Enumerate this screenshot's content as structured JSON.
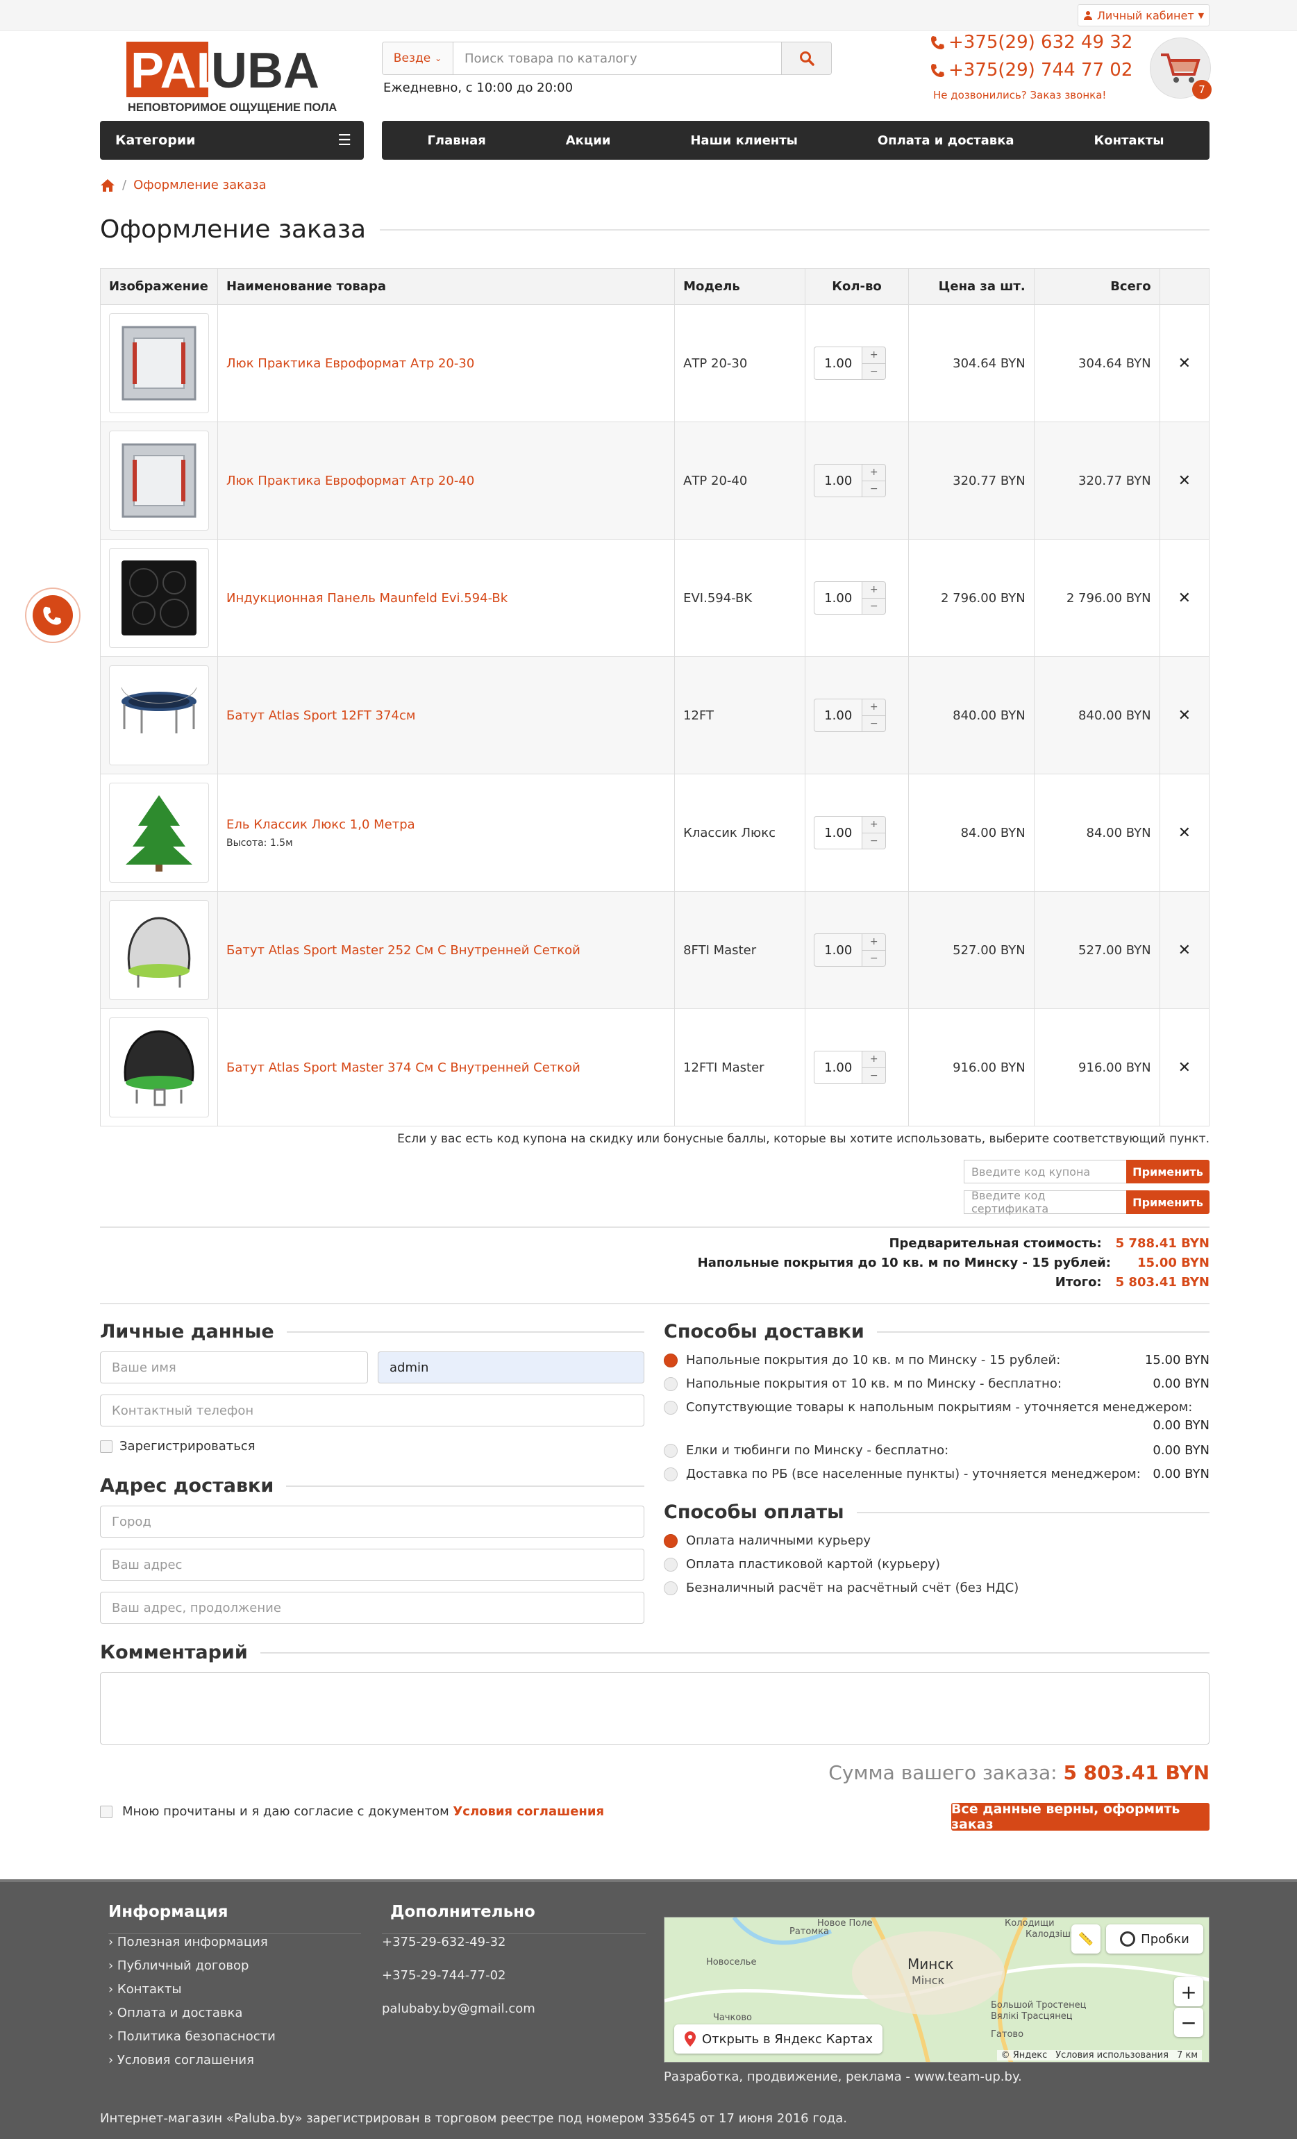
{
  "header": {
    "account_label": "Личный кабинет",
    "logo_text_1": "PAL",
    "logo_text_2": "UBA",
    "logo_slogan": "НЕПОВТОРИМОЕ ОЩУЩЕНИЕ ПОЛА",
    "search_scope": "Везде",
    "search_placeholder": "Поиск товара по каталогу",
    "hours": "Ежедневно, с 10:00 до 20:00",
    "phone_1": "+375(29) 632 49 32",
    "phone_2": "+375(29) 744 77 02",
    "callback": "Не дозвонились? Заказ звонка!",
    "cart_count": "7",
    "categories_label": "Категории",
    "menu": [
      "Главная",
      "Акции",
      "Наши клиенты",
      "Оплата и доставка",
      "Контакты"
    ]
  },
  "breadcrumb": {
    "current": "Оформление заказа"
  },
  "page_title": "Оформление заказа",
  "cart_table": {
    "headers": [
      "Изображение",
      "Наименование товара",
      "Модель",
      "Кол-во",
      "Цена за шт.",
      "Всего"
    ],
    "rows": [
      {
        "name": "Люк Практика Евроформат Атр 20-30",
        "option": "",
        "model": "АТР 20-30",
        "qty": "1.00",
        "price": "304.64 BYN",
        "total": "304.64 BYN",
        "image": "hatch-icon"
      },
      {
        "name": "Люк Практика Евроформат Атр 20-40",
        "option": "",
        "model": "АТР 20-40",
        "qty": "1.00",
        "price": "320.77 BYN",
        "total": "320.77 BYN",
        "image": "hatch-icon"
      },
      {
        "name": "Индукционная Панель Maunfeld Evi.594-Bk",
        "option": "",
        "model": "EVI.594-BK",
        "qty": "1.00",
        "price": "2 796.00 BYN",
        "total": "2 796.00 BYN",
        "image": "cooktop-icon"
      },
      {
        "name": "Батут Atlas Sport 12FT 374см",
        "option": "",
        "model": "12FT",
        "qty": "1.00",
        "price": "840.00 BYN",
        "total": "840.00 BYN",
        "image": "trampoline-icon"
      },
      {
        "name": "Ель Классик Люкс 1,0 Метра",
        "option": "Высота: 1.5м",
        "model": "Классик Люкс",
        "qty": "1.00",
        "price": "84.00 BYN",
        "total": "84.00 BYN",
        "image": "fir-tree-icon"
      },
      {
        "name": "Батут Atlas Sport Master 252 См С Внутренней Сеткой",
        "option": "",
        "model": "8FTI Master",
        "qty": "1.00",
        "price": "527.00 BYN",
        "total": "527.00 BYN",
        "image": "trampoline-net-icon"
      },
      {
        "name": "Батут Atlas Sport Master 374 См С Внутренней Сеткой",
        "option": "",
        "model": "12FTI Master",
        "qty": "1.00",
        "price": "916.00 BYN",
        "total": "916.00 BYN",
        "image": "trampoline-net-icon"
      }
    ],
    "remove_symbol": "✕",
    "plus": "+",
    "minus": "−"
  },
  "coupon": {
    "note": "Если у вас есть код купона на скидку или бонусные баллы, которые вы хотите использовать, выберите соответствующий пункт.",
    "coupon_placeholder": "Введите код купона",
    "cert_placeholder": "Введите код сертификата",
    "apply": "Применить"
  },
  "totals": [
    {
      "label": "Предварительная стоимость:",
      "value": "5 788.41 BYN"
    },
    {
      "label": "Напольные покрытия до 10 кв. м по Минску - 15 рублей:",
      "value": "15.00 BYN"
    },
    {
      "label": "Итого:",
      "value": "5 803.41 BYN"
    }
  ],
  "personal": {
    "title": "Личные данные",
    "name_placeholder": "Ваше имя",
    "second_value": "admin",
    "phone_placeholder": "Контактный телефон",
    "register": "Зарегистрироваться"
  },
  "address": {
    "title": "Адрес доставки",
    "city": "Город",
    "addr": "Ваш адрес",
    "addr2": "Ваш адрес, продолжение"
  },
  "delivery": {
    "title": "Способы доставки",
    "options": [
      {
        "label": "Напольные покрытия до 10 кв. м по Минску - 15 рублей:",
        "price": "15.00 BYN"
      },
      {
        "label": "Напольные покрытия от 10 кв. м по Минску - бесплатно:",
        "price": "0.00 BYN"
      },
      {
        "label": "Сопутствующие товары к напольным покрытиям - уточняется менеджером:",
        "price": "0.00 BYN"
      },
      {
        "label": "Елки и тюбинги по Минску - бесплатно:",
        "price": "0.00 BYN"
      },
      {
        "label": "Доставка по РБ (все населенные пункты) - уточняется менеджером:",
        "price": "0.00 BYN"
      }
    ]
  },
  "payment": {
    "title": "Способы оплаты",
    "options": [
      "Оплата наличными курьеру",
      "Оплата пластиковой картой (курьеру)",
      "Безналичный расчёт на расчётный счёт (без НДС)"
    ]
  },
  "comment_title": "Комментарий",
  "order_sum": {
    "label": "Сумма вашего заказа:",
    "value": "5 803.41 BYN"
  },
  "agree": {
    "text": "Мною прочитаны и я даю согласие с документом",
    "link": "Условия соглашения"
  },
  "confirm_label": "Все данные верны, оформить заказ",
  "footer": {
    "info_title": "Информация",
    "info_links": [
      "Полезная информация",
      "Публичный договор",
      "Контакты",
      "Оплата и доставка",
      "Политика безопасности",
      "Условия соглашения"
    ],
    "extra_title": "Дополнительно",
    "extra_items": [
      "+375-29-632-49-32",
      "+375-29-744-77-02",
      "palubaby.by@gmail.com"
    ],
    "map": {
      "open_label": "Открыть в Яндекс Картах",
      "traffic_label": "Пробки",
      "city_ru": "Минск",
      "city_by": "Мінск",
      "places": [
        "Ратомка",
        "Новосельe",
        "Новое Поле",
        "Новосельe Наваселе",
        "Колодищи",
        "Калодзішчы",
        "Чачково",
        "Большой Тростенец",
        "Вялікі Трасцянец",
        "Гатово"
      ],
      "copyright": "© Яндекс",
      "terms": "Условия использования",
      "scale": "7 км",
      "zoom_in": "+",
      "zoom_out": "−"
    },
    "dev": "Разработка, продвижение, реклама - www.team-up.by.",
    "legal": "Интернет-магазин «Paluba.by» зарегистрирован в торговом реестре под номером 335645 от 17 июня 2016 года."
  },
  "colors": {
    "accent": "#d64817",
    "dark": "#2b2b2b",
    "footer": "#5a5a5a"
  }
}
